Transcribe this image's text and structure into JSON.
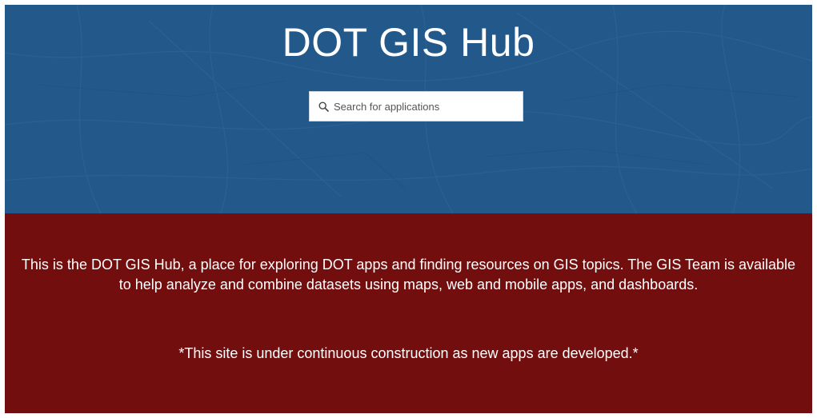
{
  "hero": {
    "title": "DOT GIS Hub",
    "background_color": "#22598a"
  },
  "search": {
    "placeholder": "Search for applications",
    "icon": "search-icon"
  },
  "info": {
    "background_color": "#720e0e",
    "description": "This is the DOT GIS Hub, a place for exploring DOT apps and finding resources on GIS topics. The GIS Team is available to help analyze and combine datasets using maps, web and mobile apps, and dashboards.",
    "note": "*This site is under continuous construction as new apps are developed.*"
  }
}
